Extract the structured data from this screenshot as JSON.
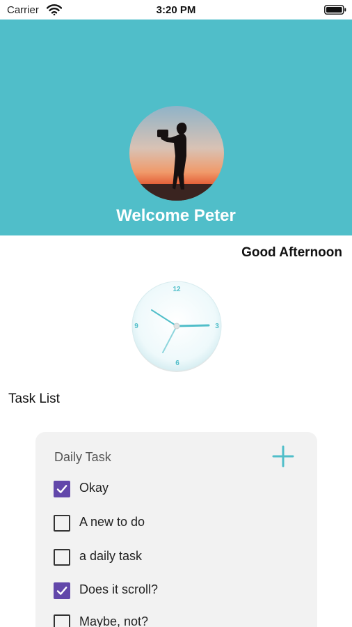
{
  "status_bar": {
    "carrier": "Carrier",
    "time": "3:20 PM",
    "icons": [
      "wifi-icon",
      "battery-icon"
    ]
  },
  "header": {
    "background_color": "#50bec9",
    "welcome_text": "Welcome Peter"
  },
  "greeting": "Good Afternoon",
  "clock": {
    "numbers": [
      "12",
      "3",
      "6",
      "9"
    ],
    "accent_color": "#50bec9"
  },
  "task_list_label": "Task List",
  "task_card": {
    "title": "Daily Task",
    "add_icon": "plus-icon",
    "check_color": "#6247aa",
    "tasks": [
      {
        "label": "Okay",
        "checked": true
      },
      {
        "label": "A new to do",
        "checked": false
      },
      {
        "label": "a daily task",
        "checked": false
      },
      {
        "label": "Does it scroll?",
        "checked": true
      },
      {
        "label": "Maybe, not?",
        "checked": false
      }
    ]
  }
}
